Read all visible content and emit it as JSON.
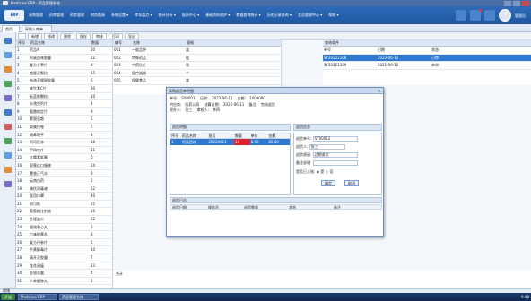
{
  "window": {
    "title": "Medicine ERP - 药品管理系统"
  },
  "menubar": {
    "logo": "ERP",
    "items": [
      "采购管理",
      "药库管理",
      "药房管理",
      "财务报表",
      "系统设置 ▾",
      "库存盘点 ▾",
      "统计分析 ▾",
      "报表中心 ▾",
      "基础资料维护 ▾",
      "数据查询统计 ▾",
      "历史记录查询 ▾",
      "会员管理中心 ▾",
      "帮助 ▾"
    ],
    "user": "管理员"
  },
  "tabs": [
    {
      "label": "首页"
    },
    {
      "label": "采购入库单"
    }
  ],
  "toolbar": {
    "buttons": [
      "新增",
      "修改",
      "删除",
      "保存",
      "审核",
      "打印",
      "导出"
    ]
  },
  "mainlist": {
    "headers": [
      "序号",
      "药品名称",
      "数量"
    ],
    "rows": [
      [
        "1",
        "药品A",
        "20"
      ],
      [
        "2",
        "阿莫西林胶囊",
        "12"
      ],
      [
        "3",
        "复方甘草片",
        "8"
      ],
      [
        "4",
        "感冒灵颗粒",
        "15"
      ],
      [
        "5",
        "布洛芬缓释胶囊",
        "6"
      ],
      [
        "6",
        "维生素C片",
        "30"
      ],
      [
        "7",
        "板蓝根颗粒",
        "10"
      ],
      [
        "8",
        "头孢克肟片",
        "4"
      ],
      [
        "9",
        "氯雷他定片",
        "9"
      ],
      [
        "10",
        "蒙脱石散",
        "5"
      ],
      [
        "11",
        "奥美拉唑",
        "7"
      ],
      [
        "12",
        "硝苯地平",
        "3"
      ],
      [
        "13",
        "阿司匹林",
        "18"
      ],
      [
        "14",
        "甲硝唑片",
        "11"
      ],
      [
        "15",
        "红霉素软膏",
        "6"
      ],
      [
        "16",
        "双黄连口服液",
        "14"
      ],
      [
        "17",
        "藿香正气水",
        "9"
      ],
      [
        "18",
        "云南白药",
        "2"
      ],
      [
        "19",
        "碘伏消毒液",
        "12"
      ],
      [
        "20",
        "医用口罩",
        "40"
      ],
      [
        "21",
        "创可贴",
        "25"
      ],
      [
        "22",
        "葡萄糖注射液",
        "16"
      ],
      [
        "23",
        "生理盐水",
        "22"
      ],
      [
        "24",
        "速效救心丸",
        "3"
      ],
      [
        "25",
        "六味地黄丸",
        "8"
      ],
      [
        "26",
        "复方丹参片",
        "5"
      ],
      [
        "27",
        "牛黄解毒片",
        "10"
      ],
      [
        "28",
        "清开灵胶囊",
        "7"
      ],
      [
        "29",
        "连花清瘟",
        "13"
      ],
      [
        "30",
        "金银花露",
        "4"
      ],
      [
        "31",
        "人参健脾丸",
        "2"
      ]
    ]
  },
  "midlist": {
    "headers": [
      "编号",
      "名称",
      "规格"
    ],
    "rows": [
      [
        "001",
        "一般品种",
        "盒"
      ],
      [
        "002",
        "特殊药品",
        "瓶"
      ],
      [
        "003",
        "中药饮片",
        "袋"
      ],
      [
        "004",
        "医疗器械",
        "个"
      ],
      [
        "005",
        "保健食品",
        "盒"
      ]
    ]
  },
  "rightpanel": {
    "header": "查询条件",
    "rows": [
      [
        "单号",
        "日期",
        "状态"
      ],
      [
        "SY20221108",
        "2022-06-11",
        "已审"
      ],
      [
        "SY20221109",
        "2022-06-12",
        "未审"
      ]
    ]
  },
  "dialog": {
    "title": "采购退货单明细",
    "close": "×",
    "info": [
      [
        "单号:",
        "SY0001",
        "日期:",
        "2022-06-11",
        "金额:",
        "1008090"
      ],
      [
        "供应商:",
        "医药公司",
        "结算日期:",
        "2022-06-11",
        "备注:",
        "完成退货"
      ],
      [
        "经办人:",
        "张三",
        "审核人:",
        "李四"
      ]
    ],
    "sec_left": "退货明细",
    "sec_right": "退货信息",
    "table_headers": [
      "序号",
      "药品名称",
      "批号",
      "数量",
      "单价",
      "金额"
    ],
    "selected_row": [
      "1",
      "阿莫西林",
      "20220611",
      "10",
      "8.50",
      "85.00"
    ],
    "form": {
      "f1_label": "退货单号:",
      "f1_value": "SY00012",
      "f2_label": "退货人:",
      "f2_value": "张三",
      "f3_label": "退货原因:",
      "f3_value": "过期退货",
      "f4_label": "备注说明:",
      "f4_value": "",
      "f5_label": "是否已入账:",
      "f5_opt1": "是",
      "f5_opt2": "否",
      "ok": "确定",
      "cancel": "取消"
    },
    "lower_header": "退货日志",
    "lower_cols": [
      "退货日期",
      "操作员",
      "退货数量",
      "状态",
      "备注"
    ]
  },
  "midlower": {
    "text": "合计"
  },
  "statusbar": {
    "text": "就绪"
  },
  "taskbar": {
    "start": "开始",
    "tasks": [
      "Medicine ERP",
      "药品管理系统"
    ],
    "clock": "9:48"
  }
}
